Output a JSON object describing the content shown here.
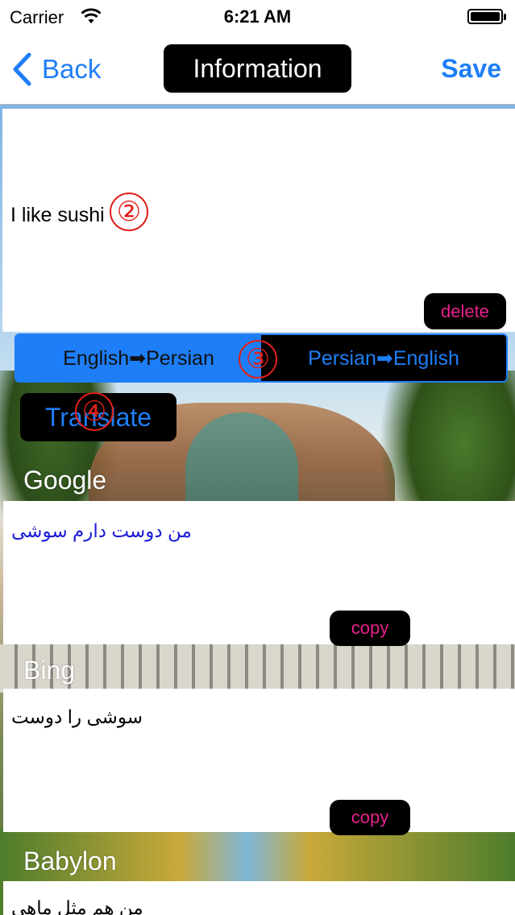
{
  "status_bar": {
    "carrier": "Carrier",
    "time": "6:21 AM",
    "wifi_icon": "wifi-icon",
    "battery_icon": "battery-icon"
  },
  "nav": {
    "back_label": "Back",
    "title": "Information",
    "save_label": "Save",
    "accent_color": "#1e7ef7"
  },
  "input": {
    "text": "I like sushi",
    "delete_label": "delete"
  },
  "direction": {
    "options": [
      "English➡Persian",
      "Persian➡English"
    ],
    "selected": "English➡Persian"
  },
  "translate_label": "Translate",
  "markers": [
    "②",
    "③",
    "④"
  ],
  "results": [
    {
      "provider": "Google",
      "text": "من دوست دارم سوشی",
      "text_color": "#1a1ad6",
      "copy_label": "copy"
    },
    {
      "provider": "Bing",
      "text": "سوشی را دوست",
      "text_color": "#000000",
      "copy_label": "copy"
    },
    {
      "provider": "Babylon",
      "text": "من هم مثل ماهی",
      "text_color": "#000000"
    }
  ],
  "colors": {
    "copy_text": "#e8218c",
    "marker": "#e0201a"
  }
}
